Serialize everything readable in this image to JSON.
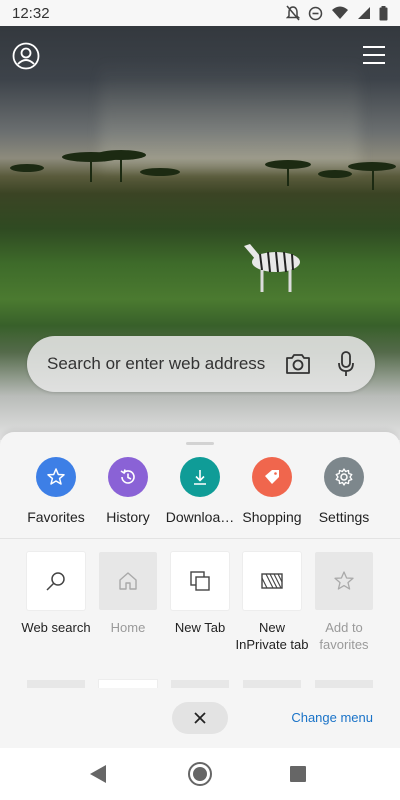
{
  "status_bar": {
    "time": "12:32"
  },
  "search": {
    "placeholder": "Search or enter web address"
  },
  "quick_actions": [
    {
      "label": "Favorites",
      "icon": "star-icon",
      "color": "#3d7fe6"
    },
    {
      "label": "History",
      "icon": "history-icon",
      "color": "#8a62d6"
    },
    {
      "label": "Downloa…",
      "icon": "download-icon",
      "color": "#0f9c97"
    },
    {
      "label": "Shopping",
      "icon": "shopping-tag-icon",
      "color": "#f0664d"
    },
    {
      "label": "Settings",
      "icon": "gear-icon",
      "color": "#7d878c"
    }
  ],
  "tiles": [
    {
      "label": "Web search",
      "icon": "search-icon",
      "enabled": true
    },
    {
      "label": "Home",
      "icon": "home-icon",
      "enabled": false
    },
    {
      "label": "New Tab",
      "icon": "new-tab-icon",
      "enabled": true
    },
    {
      "label": "New InPrivate tab",
      "icon": "inprivate-icon",
      "enabled": true
    },
    {
      "label": "Add to favorites",
      "icon": "star-outline-icon",
      "enabled": false
    }
  ],
  "footer": {
    "change_menu": "Change menu"
  },
  "colors": {
    "accent_link": "#1a73c8"
  }
}
